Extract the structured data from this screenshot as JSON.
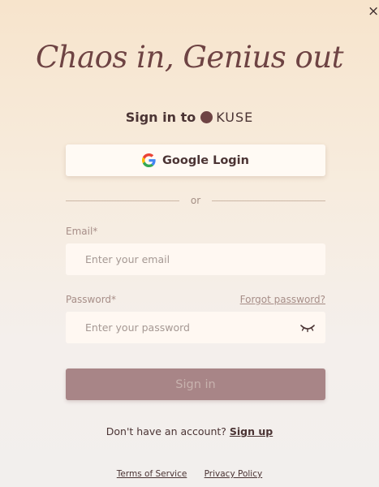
{
  "close_label": "×",
  "headline": "Chaos in, Genius out",
  "signin_to": {
    "prefix": "Sign in to",
    "brand": "KUSE"
  },
  "google_button": {
    "label": "Google Login",
    "icon": "google-icon"
  },
  "divider_text": "or",
  "email": {
    "label": "Email*",
    "placeholder": "Enter your email",
    "value": ""
  },
  "password": {
    "label": "Password*",
    "placeholder": "Enter your password",
    "value": "",
    "forgot_label": "Forgot password?",
    "toggle_icon": "eye-closed-icon"
  },
  "signin_button": {
    "label": "Sign in"
  },
  "signup": {
    "prompt": "Don't have an account?",
    "link_label": "Sign up"
  },
  "footer": {
    "terms_label": "Terms of Service",
    "privacy_label": "Privacy Policy"
  },
  "colors": {
    "brand": "#6e4343",
    "signin_button": "#a88587",
    "input_bg": "#fff8f2"
  }
}
